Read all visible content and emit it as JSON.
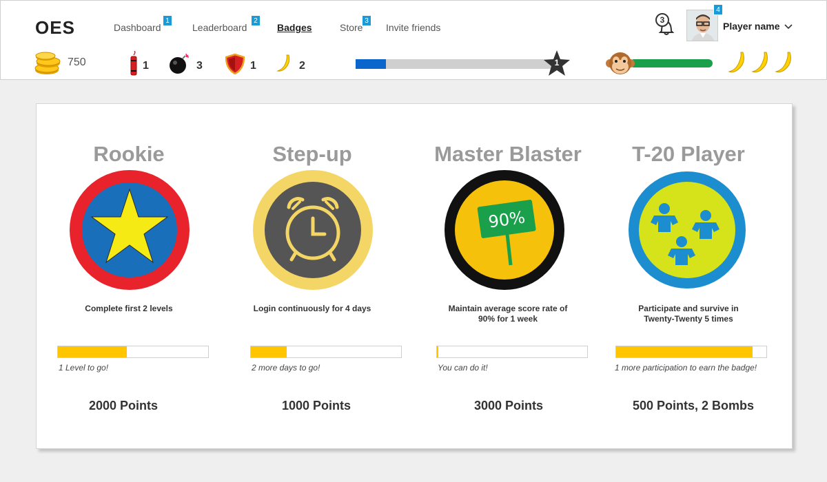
{
  "app": {
    "logo": "OES"
  },
  "nav": {
    "items": [
      {
        "label": "Dashboard",
        "badge": "1"
      },
      {
        "label": "Leaderboard",
        "badge": "2"
      },
      {
        "label": "Badges",
        "badge": ""
      },
      {
        "label": "Store",
        "badge": "3"
      },
      {
        "label": "Invite friends",
        "badge": ""
      }
    ],
    "notifications_count": "3",
    "profile_badge": "4",
    "player_name": "Player name"
  },
  "stats": {
    "coins": "750",
    "dynamite": "1",
    "bombs": "3",
    "shields": "1",
    "bananas": "2",
    "xp_progress": 0.15,
    "level": "1",
    "health_progress": 1.0,
    "lives": 3
  },
  "badges": [
    {
      "title": "Rookie",
      "icon": "star-icon",
      "description": "Complete first 2 levels",
      "progress": 0.46,
      "note": "1 Level to go!",
      "points": "2000 Points"
    },
    {
      "title": "Step-up",
      "icon": "alarm-clock-icon",
      "description": "Login continuously for 4 days",
      "progress": 0.24,
      "note": "2 more days  to go!",
      "points": "1000 Points"
    },
    {
      "title": "Master Blaster",
      "icon": "score-sign-icon",
      "sign_text": "90%",
      "description": "Maintain average score rate of 90% for 1 week",
      "progress": 0.01,
      "note": "You can do it!",
      "points": "3000 Points"
    },
    {
      "title": "T-20 Player",
      "icon": "team-icon",
      "description": "Participate and survive in Twenty-Twenty 5 times",
      "progress": 0.91,
      "note": "1 more participation to earn the badge!",
      "points": "500 Points, 2 Bombs"
    }
  ],
  "colors": {
    "accent_blue": "#0a66cc",
    "progress_yellow": "#ffc600",
    "health_green": "#1aa04a",
    "title_grey": "#9a9a9a"
  }
}
